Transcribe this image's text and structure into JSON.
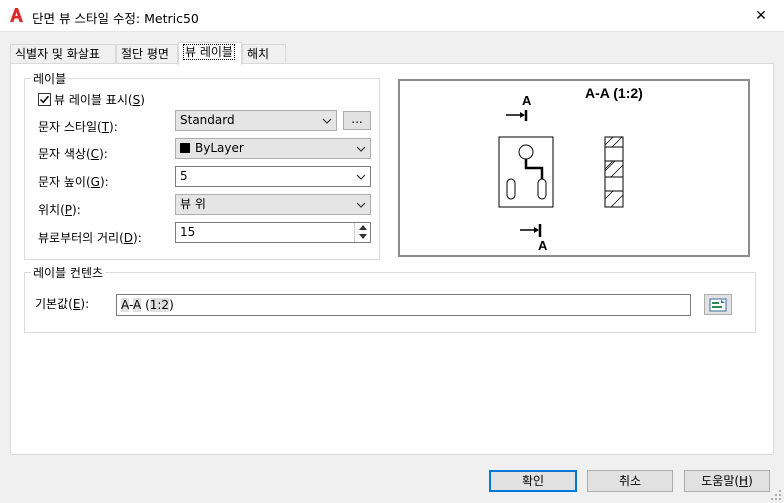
{
  "window": {
    "title": "단면 뷰 스타일 수정: Metric50",
    "close_glyph": "✕"
  },
  "tabs": [
    {
      "label": "식별자 및 화살표"
    },
    {
      "label": "절단 평면"
    },
    {
      "label": "뷰 레이블"
    },
    {
      "label": "해치"
    }
  ],
  "label_group": {
    "title": "레이블",
    "show_label": {
      "label_a": "뷰 레이블 표시(",
      "key": "S",
      "label_b": ")",
      "checked": true
    },
    "text_style": {
      "label_a": "문자 스타일(",
      "key": "T",
      "label_b": "):",
      "value": "Standard",
      "browse_label": "..."
    },
    "text_color": {
      "label_a": "문자 색상(",
      "key": "C",
      "label_b": "):",
      "value": "ByLayer",
      "swatch_color": "#000000"
    },
    "text_height": {
      "label_a": "문자 높이(",
      "key": "G",
      "label_b": "):",
      "value": "5"
    },
    "position": {
      "label_a": "위치(",
      "key": "P",
      "label_b": "):",
      "value": "뷰 위"
    },
    "distance": {
      "label_a": "뷰로부터의 거리(",
      "key": "D",
      "label_b": "):",
      "value": "15"
    }
  },
  "preview": {
    "title": "A-A (1:2)",
    "top_marker": "A",
    "bottom_marker": "A"
  },
  "contents_group": {
    "title": "레이블 컨텐츠",
    "default": {
      "label_a": "기본값(",
      "key": "E",
      "label_b": "):",
      "value_part1": "A",
      "value_part2": "-",
      "value_part3": "A",
      "value_part4": " (",
      "value_part5": "1:2",
      "value_part6": ")"
    }
  },
  "buttons": {
    "ok": {
      "label": "확인"
    },
    "cancel": {
      "label": "취소"
    },
    "help": {
      "label_a": "도움말(",
      "key": "H",
      "label_b": ")"
    }
  },
  "colors": {
    "accent": "#0078d7",
    "logo_red": "#d92b2b"
  }
}
